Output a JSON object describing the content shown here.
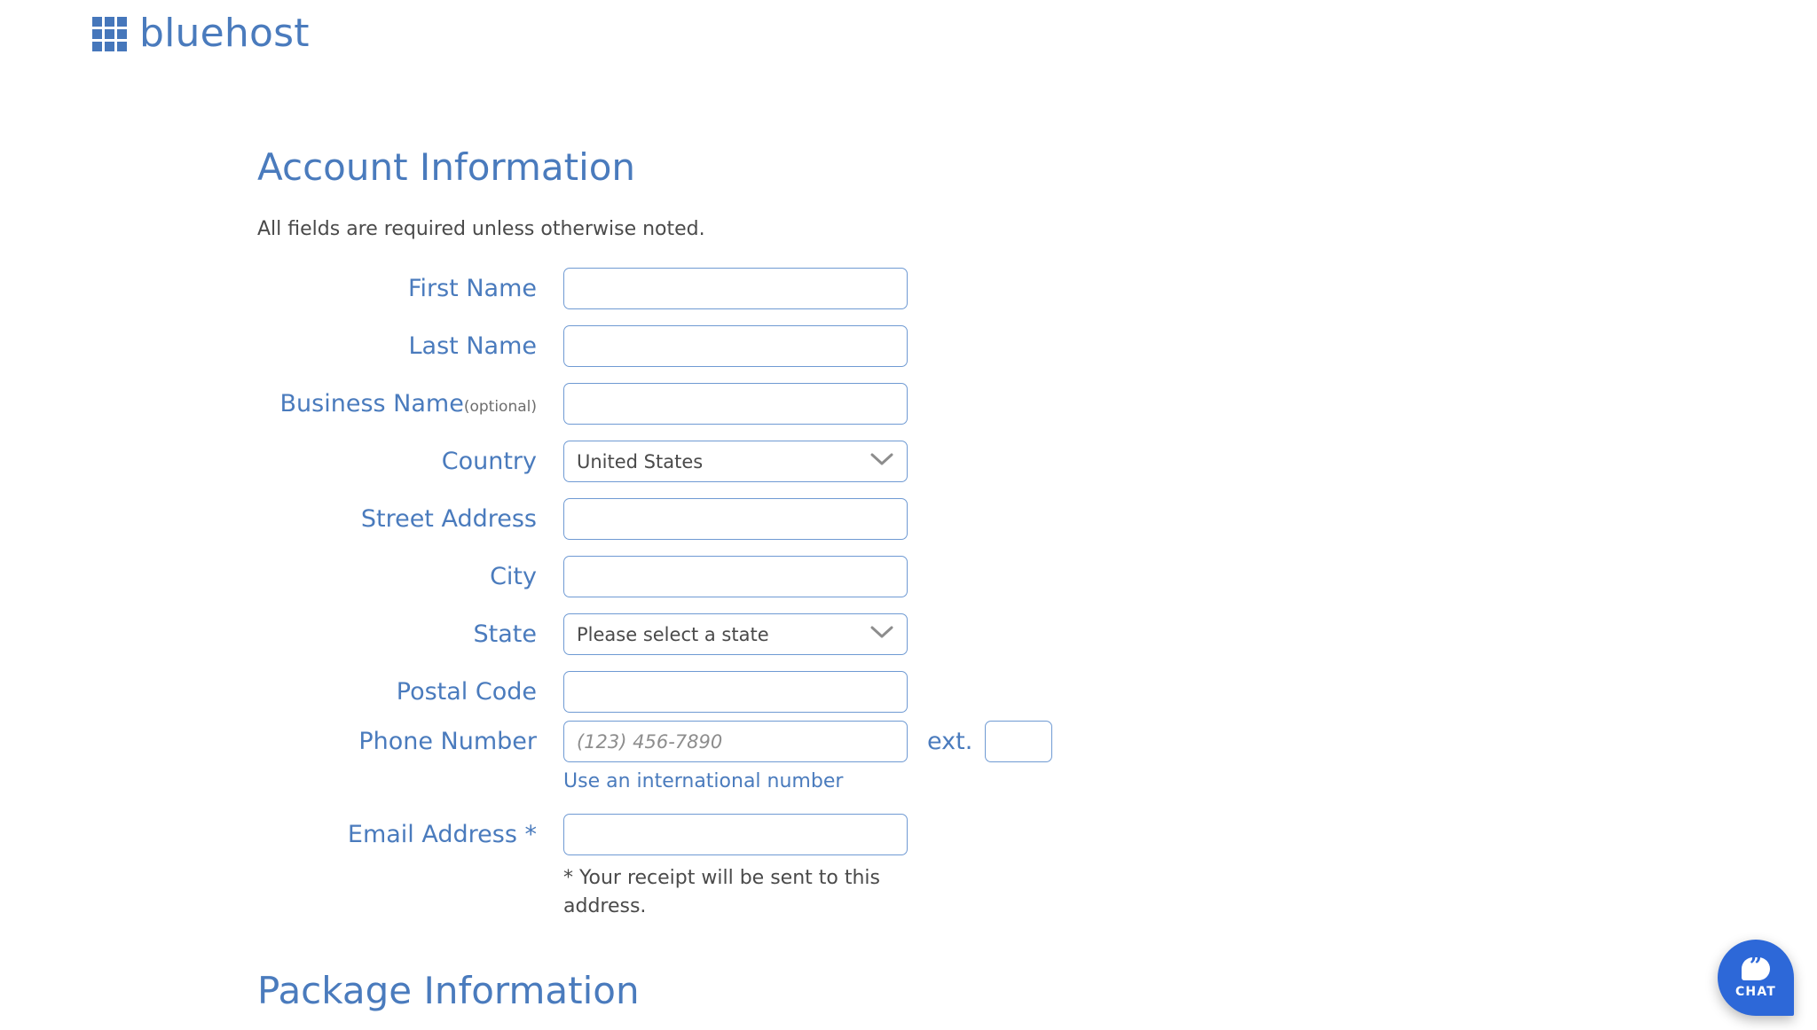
{
  "brand": {
    "name": "bluehost",
    "logo_icon": "grid-3x3-icon",
    "color": "#4a7bbd"
  },
  "account_section": {
    "title": "Account Information",
    "note": "All fields are required unless otherwise noted."
  },
  "fields": {
    "first_name": {
      "label": "First Name",
      "value": "",
      "placeholder": ""
    },
    "last_name": {
      "label": "Last Name",
      "value": "",
      "placeholder": ""
    },
    "business_name": {
      "label": "Business Name",
      "optional_tag": "(optional)",
      "value": "",
      "placeholder": ""
    },
    "country": {
      "label": "Country",
      "value": "United States",
      "chevron_icon": "chevron-down-icon"
    },
    "street_address": {
      "label": "Street Address",
      "value": "",
      "placeholder": ""
    },
    "city": {
      "label": "City",
      "value": "",
      "placeholder": ""
    },
    "state": {
      "label": "State",
      "value": "Please select a state",
      "chevron_icon": "chevron-down-icon"
    },
    "postal_code": {
      "label": "Postal Code",
      "value": "",
      "placeholder": ""
    },
    "phone_number": {
      "label": "Phone Number",
      "value": "",
      "placeholder": "(123) 456-7890",
      "ext_label": "ext.",
      "ext_value": "",
      "international_link": "Use an international number"
    },
    "email_address": {
      "label": "Email Address *",
      "value": "",
      "placeholder": "",
      "note": "* Your receipt will be sent to this address."
    }
  },
  "package_section": {
    "title": "Package Information"
  },
  "chat_widget": {
    "label": "CHAT",
    "icon": "chat-bubble-icon",
    "quote_glyph": "”",
    "color": "#2d68d8"
  }
}
